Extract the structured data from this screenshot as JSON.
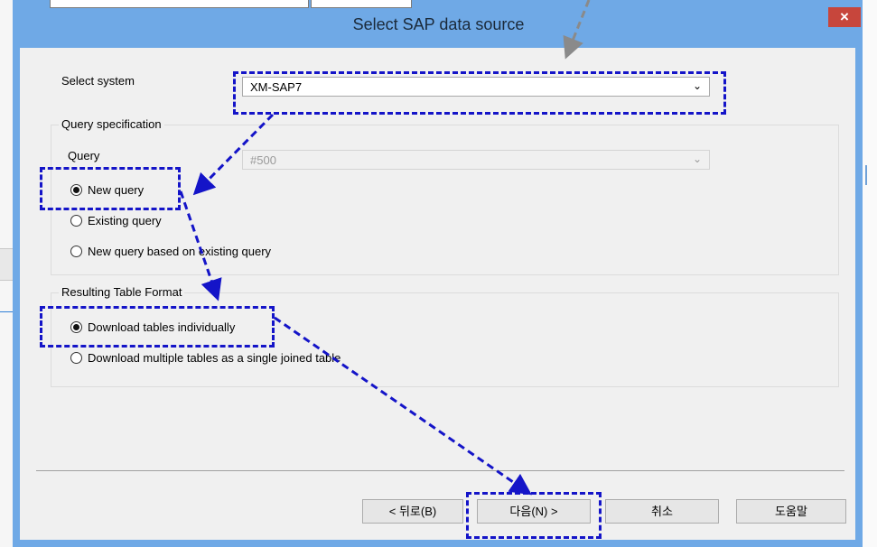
{
  "dialog": {
    "title": "Select SAP data source",
    "close_glyph": "×"
  },
  "system": {
    "label": "Select system",
    "value": "XM-SAP7",
    "arrow": "⌄"
  },
  "query_spec": {
    "group_label": "Query specification",
    "query_label": "Query",
    "query_value": "#500",
    "arrow": "⌄",
    "options": [
      "New query",
      "Existing query",
      "New query based on existing query"
    ],
    "selected_index": 0
  },
  "table_format": {
    "group_label": "Resulting Table Format",
    "options": [
      "Download tables individually",
      "Download multiple tables as a single joined table"
    ],
    "selected_index": 0
  },
  "buttons": {
    "back": "< 뒤로(B)",
    "next": "다음(N) >",
    "cancel": "취소",
    "help": "도움말"
  },
  "colors": {
    "title_bar": "#6fa9e6",
    "close_button": "#c7463c",
    "annotation": "#1414c8"
  }
}
